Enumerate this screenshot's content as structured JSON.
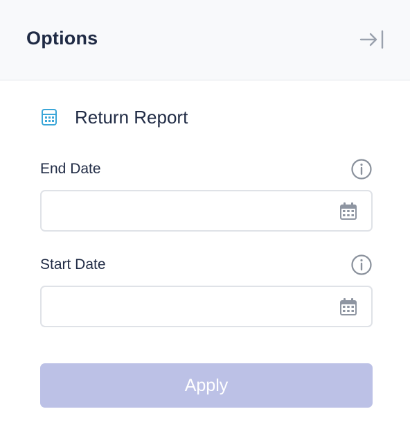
{
  "header": {
    "title": "Options",
    "collapse_icon": "collapse-right-icon"
  },
  "report": {
    "icon": "calculator-icon",
    "label": "Return Report",
    "icon_color": "#3aa6d8"
  },
  "fields": [
    {
      "label": "End Date",
      "value": "",
      "placeholder": "",
      "info_icon": "info-icon",
      "picker_icon": "calendar-icon"
    },
    {
      "label": "Start Date",
      "value": "",
      "placeholder": "",
      "info_icon": "info-icon",
      "picker_icon": "calendar-icon"
    }
  ],
  "apply": {
    "label": "Apply",
    "disabled": true,
    "color": "#bcc1e6"
  }
}
